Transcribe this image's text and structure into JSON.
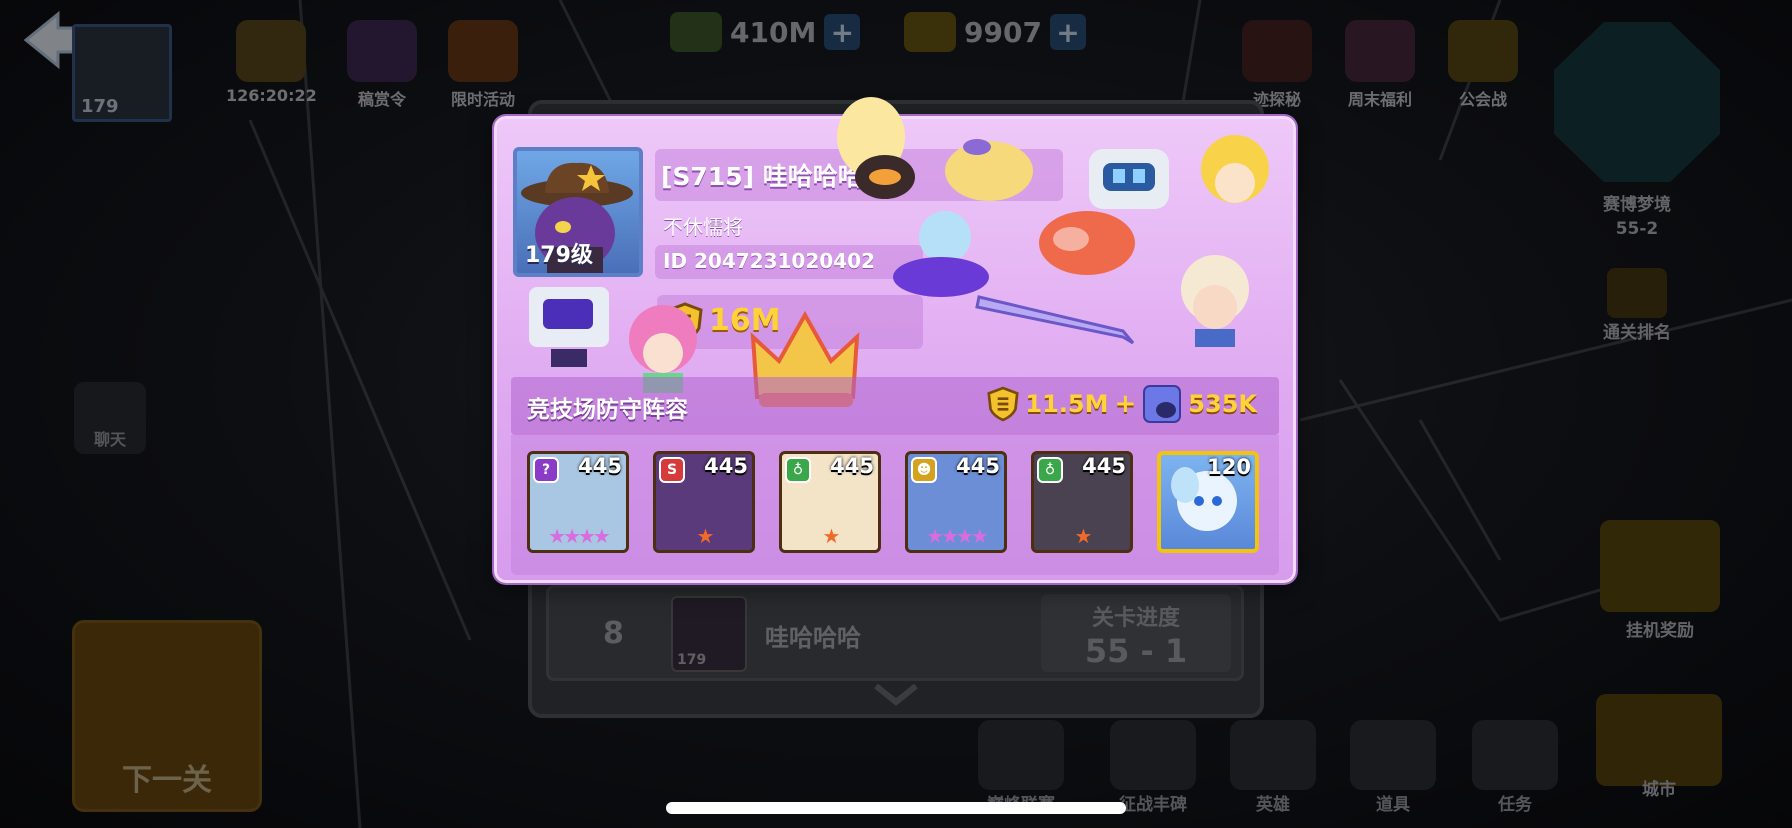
{
  "hud": {
    "currency_gold": "410M",
    "currency_gems": "9907",
    "player_level": "179",
    "timer": "126:20:22",
    "plus": "+",
    "top_items": [
      "稿赏令",
      "限时活动"
    ],
    "right_top_items": [
      "迹探秘",
      "周末福利",
      "公会战"
    ],
    "cyber_dream": {
      "label": "赛博梦境",
      "stage": "55-2"
    },
    "clear_rank": "通关排名",
    "chat": "聊天",
    "idle_reward": "挂机奖励",
    "next_stage": "下一关",
    "city": "城市"
  },
  "bottom_nav": [
    "巅峰联赛",
    "征战丰碑",
    "英雄",
    "道具",
    "任务"
  ],
  "rank_row": {
    "rank": "8",
    "avatar_level": "179",
    "name": "哇哈哈哈",
    "progress_label": "关卡进度",
    "progress_value": "55 - 1"
  },
  "profile": {
    "level_label": "179级",
    "name": "[S715] 哇哈哈哈",
    "title": "不休懦将",
    "id": "ID 2047231020402",
    "power": "16M",
    "arena_label": "竞技场防守阵容",
    "arena_power": "11.5M",
    "arena_plus": "+",
    "arena_pet_power": "535K",
    "heroes": [
      {
        "level": "445",
        "stars": "★★★★",
        "star_color": "#d86de0",
        "class_color": "#8a3cc8",
        "class_icon": "?",
        "bg": "#a9c7e3"
      },
      {
        "level": "445",
        "stars": "★",
        "star_color": "#f26a2a",
        "class_color": "#d63a3a",
        "class_icon": "S",
        "bg": "#5a3a7a"
      },
      {
        "level": "445",
        "stars": "★",
        "star_color": "#f26a2a",
        "class_color": "#3aa84a",
        "class_icon": "♁",
        "bg": "#f3e4c7"
      },
      {
        "level": "445",
        "stars": "★★★★",
        "star_color": "#d86de0",
        "class_color": "#d4a21c",
        "class_icon": "☻",
        "bg": "#6b8ed6"
      },
      {
        "level": "445",
        "stars": "★",
        "star_color": "#f26a2a",
        "class_color": "#3aa84a",
        "class_icon": "♁",
        "bg": "#4a4250"
      }
    ],
    "pet": {
      "level": "120"
    }
  },
  "colors": {
    "popup_bg": "#e4b2f4",
    "gold_text": "#ffd23a"
  }
}
